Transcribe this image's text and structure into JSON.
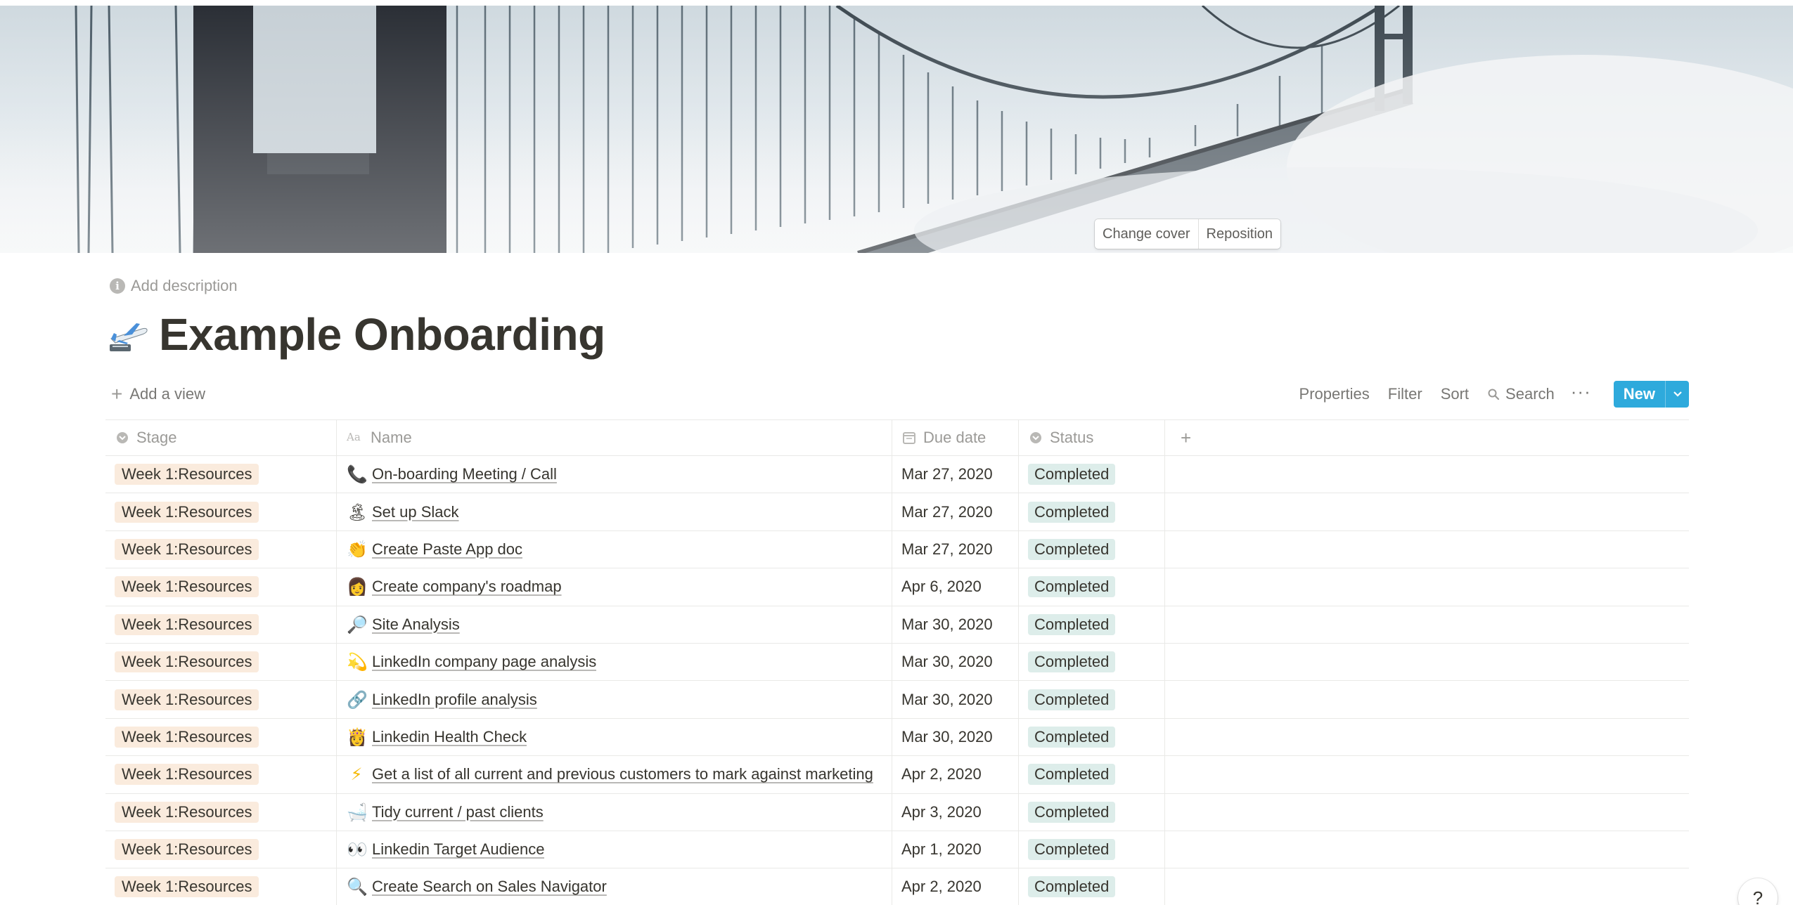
{
  "cover": {
    "change_label": "Change cover",
    "reposition_label": "Reposition"
  },
  "description": {
    "placeholder": "Add description",
    "icon": "info-icon"
  },
  "page": {
    "icon": "airplane-departure-icon",
    "title": "Example Onboarding"
  },
  "viewbar": {
    "add_view": "Add a view",
    "properties": "Properties",
    "filter": "Filter",
    "sort": "Sort",
    "search": "Search",
    "more": "···",
    "new": "New",
    "accent": "#2eaadc"
  },
  "table": {
    "columns": [
      {
        "label": "Stage",
        "icon": "select-icon"
      },
      {
        "label": "Name",
        "icon": "title-icon"
      },
      {
        "label": "Due date",
        "icon": "calendar-icon"
      },
      {
        "label": "Status",
        "icon": "select-icon"
      }
    ],
    "add_column": "+",
    "rows": [
      {
        "stage": "Week 1:Resources",
        "emoji": "📞",
        "name": "On-boarding Meeting / Call",
        "due": "Mar 27, 2020",
        "status": "Completed"
      },
      {
        "stage": "Week 1:Resources",
        "emoji": "🏝",
        "name": "Set up Slack",
        "due": "Mar 27, 2020",
        "status": "Completed"
      },
      {
        "stage": "Week 1:Resources",
        "emoji": "👏",
        "name": "Create Paste App doc",
        "due": "Mar 27, 2020",
        "status": "Completed"
      },
      {
        "stage": "Week 1:Resources",
        "emoji": "👩",
        "name": "Create company's roadmap",
        "due": "Apr 6, 2020",
        "status": "Completed"
      },
      {
        "stage": "Week 1:Resources",
        "emoji": "🔎",
        "name": "Site Analysis",
        "due": "Mar 30, 2020",
        "status": "Completed"
      },
      {
        "stage": "Week 1:Resources",
        "emoji": "💫",
        "name": "LinkedIn company page analysis",
        "due": "Mar 30, 2020",
        "status": "Completed"
      },
      {
        "stage": "Week 1:Resources",
        "emoji": "🔗",
        "name": " LinkedIn profile analysis",
        "due": "Mar 30, 2020",
        "status": "Completed"
      },
      {
        "stage": "Week 1:Resources",
        "emoji": "👸",
        "name": "Linkedin Health Check",
        "due": "Mar 30, 2020",
        "status": "Completed"
      },
      {
        "stage": "Week 1:Resources",
        "emoji": "⚡",
        "name": "Get a list of all current and previous customers to mark against marketing",
        "due": "Apr 2, 2020",
        "status": "Completed"
      },
      {
        "stage": "Week 1:Resources",
        "emoji": "🛁",
        "name": "Tidy current / past clients",
        "due": "Apr 3, 2020",
        "status": "Completed"
      },
      {
        "stage": "Week 1:Resources",
        "emoji": "👀",
        "name": "Linkedin Target Audience",
        "due": "Apr 1, 2020",
        "status": "Completed"
      },
      {
        "stage": "Week 1:Resources",
        "emoji": "🔍",
        "name": "Create Search on Sales Navigator",
        "due": "Apr 2, 2020",
        "status": "Completed"
      }
    ],
    "stage_color": "#faebdd",
    "status_color": "#ddedea"
  },
  "help": {
    "label": "?"
  }
}
